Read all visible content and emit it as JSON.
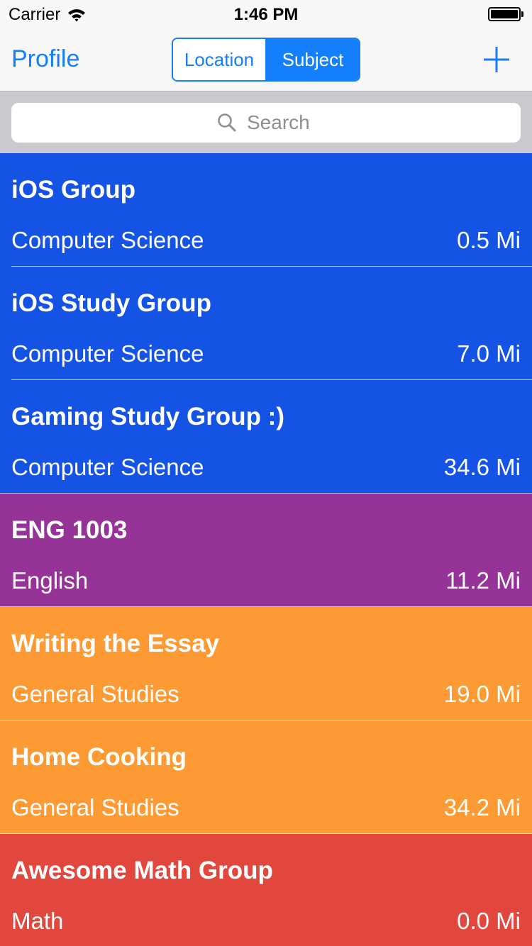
{
  "status_bar": {
    "carrier": "Carrier",
    "time": "1:46 PM",
    "icons": [
      "wifi-icon",
      "battery-icon"
    ]
  },
  "nav_bar": {
    "left_label": "Profile",
    "segments": [
      {
        "label": "Location",
        "selected": false
      },
      {
        "label": "Subject",
        "selected": true
      }
    ],
    "right_icon": "plus-icon"
  },
  "search": {
    "placeholder": "Search",
    "icon": "magnifier-icon"
  },
  "colors": {
    "accent": "#157efb",
    "computer_science": "#1453e3",
    "english": "#963396",
    "general_studies": "#fe9a33",
    "math": "#e2473d",
    "search_bar_bg": "#c9c9ce"
  },
  "groups": [
    {
      "title": "iOS Group",
      "subject": "Computer Science",
      "distance": "0.5 Mi",
      "color": "#1453e3"
    },
    {
      "title": "iOS Study Group",
      "subject": "Computer Science",
      "distance": "7.0 Mi",
      "color": "#1453e3"
    },
    {
      "title": "Gaming Study Group :)",
      "subject": "Computer Science",
      "distance": "34.6 Mi",
      "color": "#1453e3"
    },
    {
      "title": "ENG 1003",
      "subject": "English",
      "distance": "11.2 Mi",
      "color": "#963396"
    },
    {
      "title": "Writing the Essay",
      "subject": "General Studies",
      "distance": "19.0 Mi",
      "color": "#fe9a33"
    },
    {
      "title": "Home Cooking",
      "subject": "General Studies",
      "distance": "34.2 Mi",
      "color": "#fe9a33"
    },
    {
      "title": "Awesome Math Group",
      "subject": "Math",
      "distance": "0.0 Mi",
      "color": "#e2473d"
    }
  ]
}
